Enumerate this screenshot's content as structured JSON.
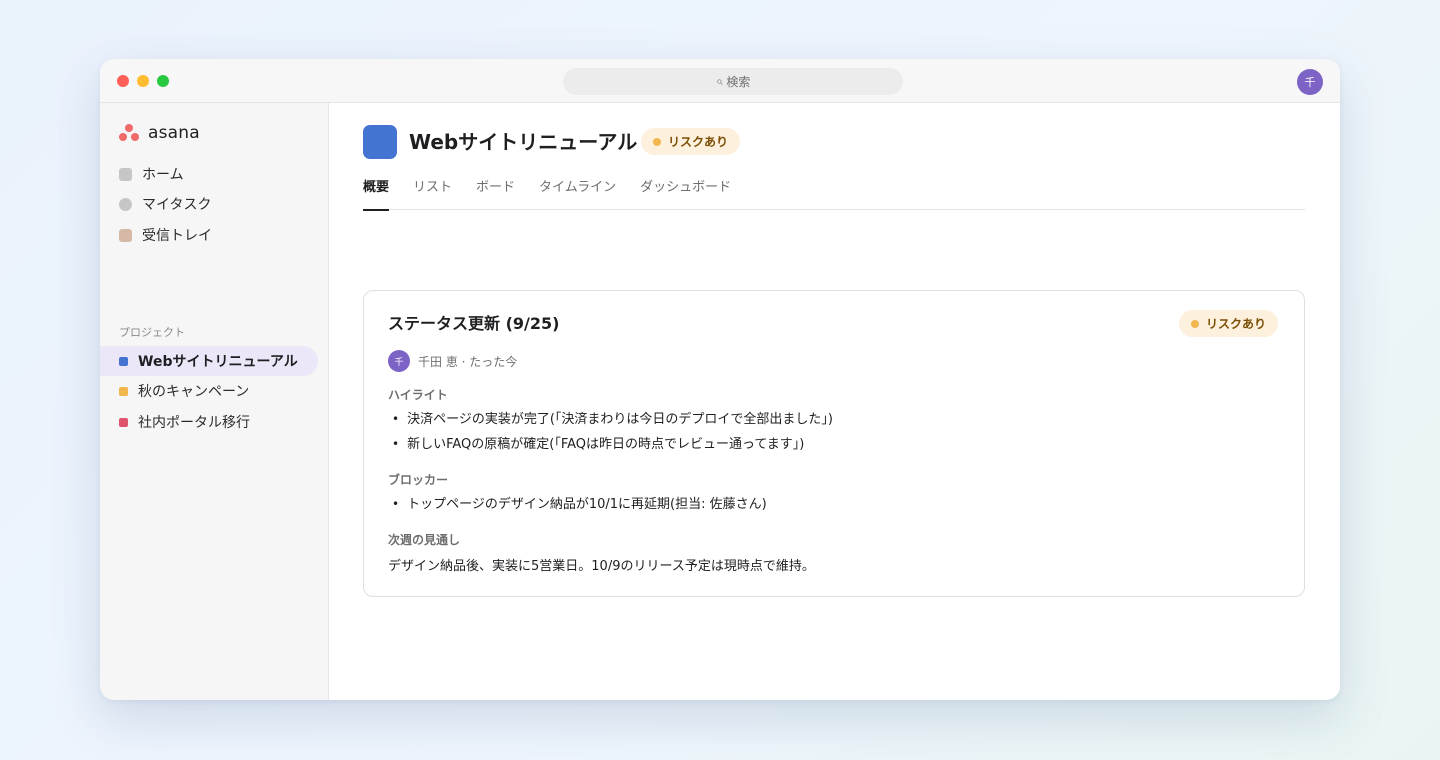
{
  "window": {
    "search": {
      "icon": "search-icon",
      "label": "検索"
    },
    "user_avatar": "千"
  },
  "sidebar": {
    "logo": "asana",
    "nav": [
      {
        "label": "ホーム",
        "icon": "home-icon"
      },
      {
        "label": "マイタスク",
        "icon": "check-circle-icon"
      },
      {
        "label": "受信トレイ",
        "icon": "inbox-icon"
      }
    ],
    "section_label": "プロジェクト",
    "projects": [
      {
        "label": "Webサイトリニューアル",
        "color": "#4573d2",
        "active": true
      },
      {
        "label": "秋のキャンペーン",
        "color": "#f1b64d",
        "active": false
      },
      {
        "label": "社内ポータル移行",
        "color": "#e0546b",
        "active": false
      }
    ]
  },
  "project": {
    "title": "Webサイトリニューアル",
    "color": "#4573d2",
    "status_badge": "リスクあり",
    "tabs": [
      "概要",
      "リスト",
      "ボード",
      "タイムライン",
      "ダッシュボード"
    ],
    "active_tab": "概要"
  },
  "status_update": {
    "title": "ステータス更新 (9/25)",
    "badge": "リスクあり",
    "author_avatar": "千",
    "author_line": "千田 恵 · たった今",
    "highlights_heading": "ハイライト",
    "highlights": [
      "決済ページの実装が完了(「決済まわりは今日のデプロイで全部出ました」)",
      "新しいFAQの原稿が確定(「FAQは昨日の時点でレビュー通ってます」)"
    ],
    "blockers_heading": "ブロッカー",
    "blockers": [
      "トップページのデザイン納品が10/1に再延期(担当: 佐藤さん)"
    ],
    "outlook_heading": "次週の見通し",
    "outlook": "デザイン納品後、実装に5営業日。10/9のリリース予定は現時点で維持。"
  },
  "colors": {
    "risk_badge_bg": "#fdf0dc",
    "risk_dot": "#f1b64d",
    "accent_active_bg": "#ebe7f8",
    "brand": "#f06a6a"
  }
}
